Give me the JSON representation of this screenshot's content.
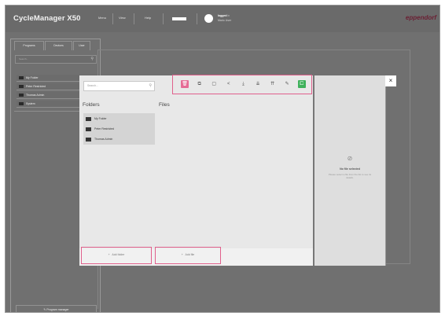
{
  "app": {
    "title": "CycleManager X50",
    "brand": "eppendorf"
  },
  "topbar": {
    "menu": [
      "Menu",
      "View",
      "Help"
    ],
    "user_name": "logged",
    "user_status": "in",
    "user_role": "Mario User"
  },
  "left_panel": {
    "tabs": [
      "Programs",
      "Devices",
      "User"
    ],
    "search_placeholder": "Search...",
    "items": [
      "My Folder",
      "Peter Restricted",
      "Thomas Admin",
      "System"
    ],
    "program_manager_label": "Program manager"
  },
  "dialog": {
    "search_placeholder": "Search...",
    "toolbar": [
      {
        "name": "delete-icon",
        "glyph": "🗑",
        "style": "pink"
      },
      {
        "name": "copy-icon",
        "glyph": "⧉",
        "style": "plain"
      },
      {
        "name": "paste-icon",
        "glyph": "▢",
        "style": "plain"
      },
      {
        "name": "share-icon",
        "glyph": "<",
        "style": "plain"
      },
      {
        "name": "download-icon",
        "glyph": "⤓",
        "style": "plain"
      },
      {
        "name": "import-icon",
        "glyph": "⇊",
        "style": "plain"
      },
      {
        "name": "move-icon",
        "glyph": "⇈",
        "style": "plain"
      },
      {
        "name": "edit-icon",
        "glyph": "✎",
        "style": "plain"
      },
      {
        "name": "export-icon",
        "glyph": "⧠",
        "style": "green"
      }
    ],
    "folders_title": "Folders",
    "files_title": "Files",
    "folders": [
      "My Folder",
      "Peter Restricted",
      "Thomas Admin"
    ],
    "add_folder_label": "Add folder",
    "add_file_label": "Add file",
    "close_glyph": "×"
  },
  "detail_panel": {
    "icon_glyph": "⊘",
    "title": "No file selected",
    "description": "Please select a file from the list to see its details."
  },
  "colors": {
    "highlight": "#e0608c",
    "delete_button": "#e56b95",
    "confirm_button": "#3fb15b",
    "brand": "#6a1f33",
    "app_background": "#707070"
  }
}
